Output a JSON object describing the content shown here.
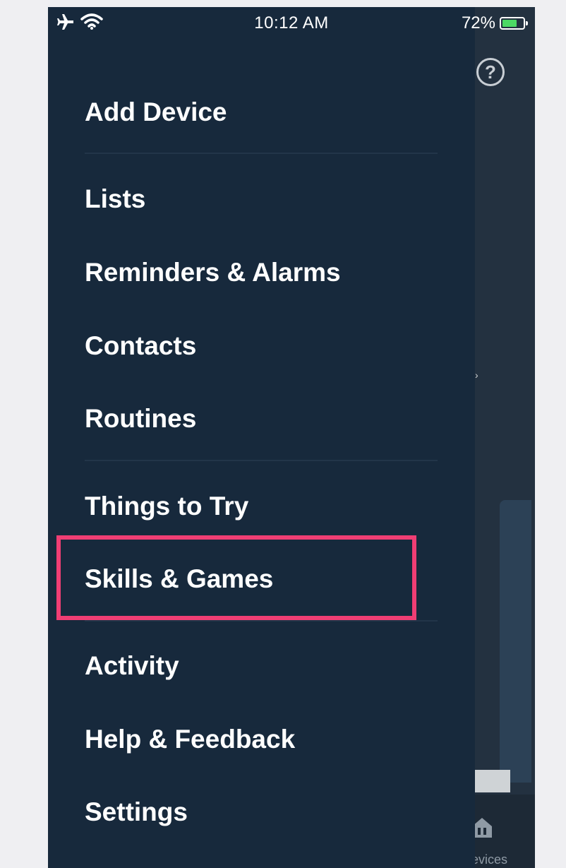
{
  "status_bar": {
    "time": "10:12 AM",
    "battery": "72%",
    "battery_level": 0.72,
    "icons": [
      "airplane-icon",
      "wifi-icon",
      "battery-icon"
    ]
  },
  "menu": {
    "items": [
      {
        "label": "Add Device"
      },
      {
        "label": "Lists"
      },
      {
        "label": "Reminders & Alarms"
      },
      {
        "label": "Contacts"
      },
      {
        "label": "Routines"
      },
      {
        "label": "Things to Try"
      },
      {
        "label": "Skills & Games"
      },
      {
        "label": "Activity"
      },
      {
        "label": "Help & Feedback"
      },
      {
        "label": "Settings"
      }
    ]
  },
  "background_app": {
    "help_icon_glyph": "?",
    "tab_label": "evices"
  },
  "colors": {
    "drawer_bg": "#17293c",
    "highlight": "#f03e74",
    "battery_fill": "#4cd964"
  }
}
